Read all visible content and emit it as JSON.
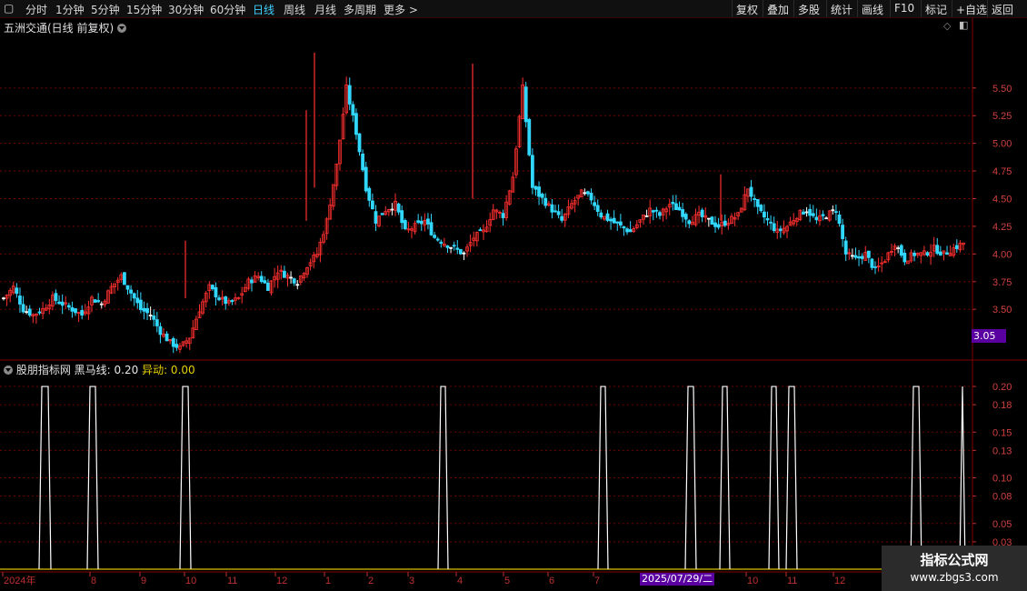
{
  "toolbar": {
    "periods": [
      "分时",
      "1分钟",
      "5分钟",
      "15分钟",
      "30分钟",
      "60分钟",
      "日线",
      "周线",
      "月线",
      "多周期",
      "更多"
    ],
    "active_period": "日线",
    "right": [
      "复权",
      "叠加",
      "多股",
      "统计",
      "画线",
      "F10",
      "标记",
      "+自选",
      "返回"
    ]
  },
  "price_panel": {
    "title": "五洲交通(日线 前复权)",
    "selected_price": "3.05"
  },
  "indicator_panel": {
    "name": "股朋指标网",
    "line1_label": "黑马线: 0.20",
    "line2_label": "异动: 0.00"
  },
  "date_badge": "2025/07/29/二",
  "watermark": {
    "title": "指标公式网",
    "url": "www.zbgs3.com"
  },
  "colors": {
    "up": "#ff3030",
    "down": "#30d8ff",
    "flat": "#ffffff",
    "grid": "#700000",
    "signal": "#ffffff",
    "zero_line": "#d8c000",
    "badge": "#5a00a0"
  },
  "chart_data": [
    {
      "type": "candlestick",
      "title": "五洲交通(日线 前复权)",
      "y_ticks": [
        "5.50",
        "5.25",
        "5.00",
        "4.75",
        "4.50",
        "4.25",
        "4.00",
        "3.75",
        "3.50"
      ],
      "ylim": [
        3.05,
        5.95
      ],
      "grid": true,
      "series_approx_close": [
        3.6,
        3.7,
        3.5,
        3.45,
        3.5,
        3.6,
        3.55,
        3.5,
        3.45,
        3.6,
        3.55,
        3.7,
        3.8,
        3.65,
        3.5,
        3.45,
        3.3,
        3.2,
        3.15,
        3.25,
        3.5,
        3.7,
        3.6,
        3.55,
        3.6,
        3.75,
        3.8,
        3.7,
        3.85,
        3.8,
        3.75,
        3.9,
        4.0,
        4.3,
        4.8,
        5.5,
        5.1,
        4.6,
        4.3,
        4.4,
        4.45,
        4.2,
        4.25,
        4.3,
        4.15,
        4.1,
        4.05,
        4.0,
        4.15,
        4.2,
        4.4,
        4.35,
        4.7,
        5.5,
        4.6,
        4.5,
        4.4,
        4.3,
        4.45,
        4.55,
        4.5,
        4.35,
        4.3,
        4.25,
        4.2,
        4.3,
        4.4,
        4.35,
        4.45,
        4.4,
        4.3,
        4.35,
        4.3,
        4.25,
        4.3,
        4.35,
        4.6,
        4.4,
        4.3,
        4.2,
        4.25,
        4.35,
        4.4,
        4.3,
        4.35,
        4.4,
        4.0,
        3.95,
        4.0,
        3.85,
        3.95,
        4.1,
        3.95,
        4.0,
        4.0,
        4.05,
        4.0,
        4.05,
        4.1
      ]
    },
    {
      "type": "line",
      "title": "股朋指标网",
      "y_ticks": [
        "0.20",
        "0.18",
        "0.15",
        "0.13",
        "0.10",
        "0.08",
        "0.05",
        "0.03"
      ],
      "ylim": [
        0,
        0.21
      ],
      "series": [
        {
          "name": "黑马线",
          "signal_bars": [
            [
              43,
              56
            ],
            [
              96,
              108
            ],
            [
              198,
              210
            ],
            [
              482,
              493
            ],
            [
              658,
              669
            ],
            [
              754,
              766
            ],
            [
              792,
              803
            ],
            [
              846,
              857
            ],
            [
              865,
              877
            ],
            [
              1002,
              1014
            ],
            [
              1056,
              1062
            ]
          ]
        },
        {
          "name": "异动",
          "values": [
            0
          ]
        }
      ]
    }
  ],
  "x_axis": {
    "labels": [
      "2024年",
      "8",
      "9",
      "10",
      "11",
      "12",
      "1",
      "2",
      "3",
      "4",
      "5",
      "6",
      "7",
      "8",
      "10",
      "11",
      "12"
    ]
  }
}
